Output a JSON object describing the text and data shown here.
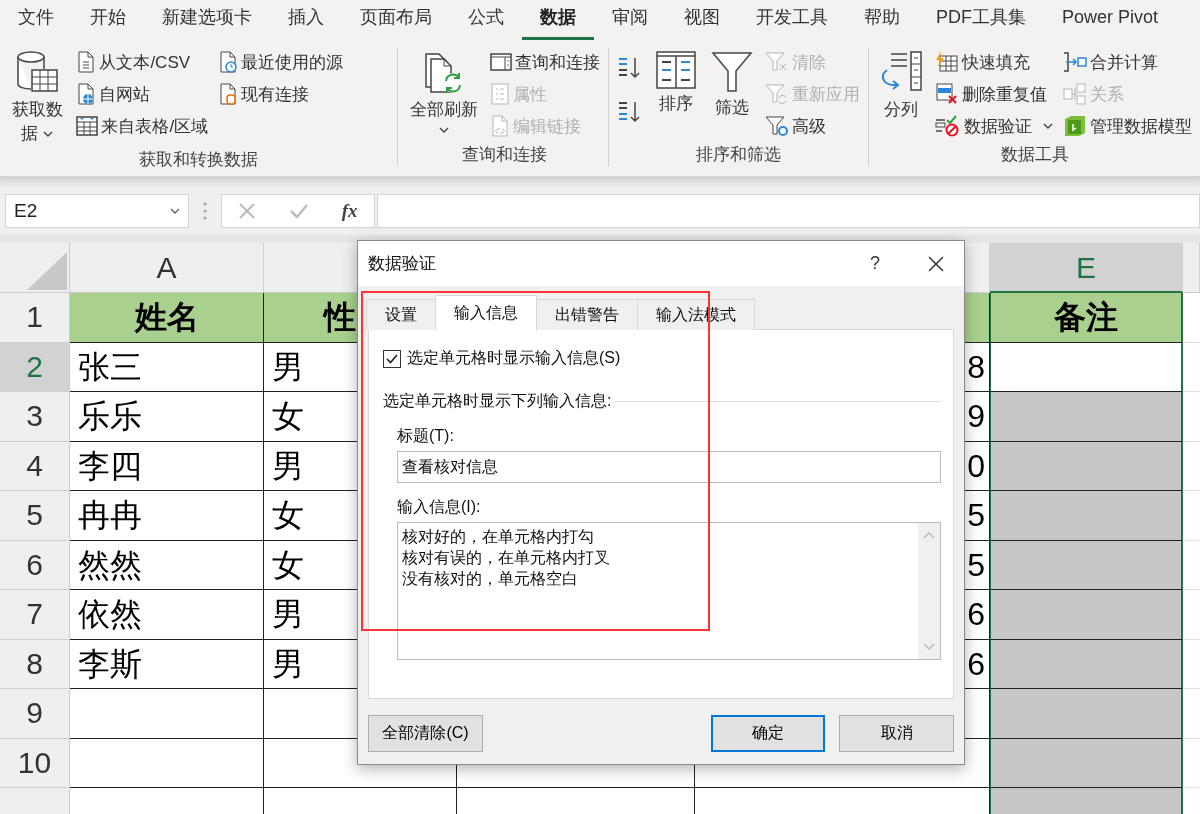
{
  "ribbon": {
    "tabs": [
      {
        "label": "文件",
        "selected": false
      },
      {
        "label": "开始",
        "selected": false
      },
      {
        "label": "新建选项卡",
        "selected": false
      },
      {
        "label": "插入",
        "selected": false
      },
      {
        "label": "页面布局",
        "selected": false
      },
      {
        "label": "公式",
        "selected": false
      },
      {
        "label": "数据",
        "selected": true
      },
      {
        "label": "审阅",
        "selected": false
      },
      {
        "label": "视图",
        "selected": false
      },
      {
        "label": "开发工具",
        "selected": false
      },
      {
        "label": "帮助",
        "selected": false
      },
      {
        "label": "PDF工具集",
        "selected": false
      },
      {
        "label": "Power Pivot",
        "selected": false
      }
    ],
    "groups": [
      {
        "title": "获取和转换数据",
        "items": [
          {
            "kind": "large",
            "label": "获取数据",
            "caret": true,
            "disabled": false
          },
          {
            "kind": "small",
            "label": "从文本/CSV",
            "disabled": false
          },
          {
            "kind": "small",
            "label": "自网站",
            "disabled": false
          },
          {
            "kind": "small",
            "label": "来自表格/区域",
            "disabled": false
          },
          {
            "kind": "small",
            "label": "最近使用的源",
            "disabled": false
          },
          {
            "kind": "small",
            "label": "现有连接",
            "disabled": false
          }
        ]
      },
      {
        "title": "查询和连接",
        "items": [
          {
            "kind": "large",
            "label": "全部刷新",
            "caret": true,
            "disabled": false
          },
          {
            "kind": "small",
            "label": "查询和连接",
            "disabled": false
          },
          {
            "kind": "small",
            "label": "属性",
            "disabled": true
          },
          {
            "kind": "small",
            "label": "编辑链接",
            "disabled": true
          }
        ]
      },
      {
        "title": "排序和筛选",
        "items": [
          {
            "kind": "icon",
            "disabled": false
          },
          {
            "kind": "icon",
            "disabled": false
          },
          {
            "kind": "large",
            "label": "排序",
            "caret": false,
            "disabled": false
          },
          {
            "kind": "large",
            "label": "筛选",
            "caret": false,
            "disabled": false
          },
          {
            "kind": "small",
            "label": "清除",
            "disabled": true
          },
          {
            "kind": "small",
            "label": "重新应用",
            "disabled": true
          },
          {
            "kind": "small",
            "label": "高级",
            "disabled": false
          }
        ]
      },
      {
        "title": "数据工具",
        "items": [
          {
            "kind": "large",
            "label": "分列",
            "caret": false,
            "disabled": false
          },
          {
            "kind": "small",
            "label": "快速填充",
            "disabled": false
          },
          {
            "kind": "small",
            "label": "删除重复值",
            "disabled": false
          },
          {
            "kind": "small",
            "label": "数据验证",
            "caret": true,
            "disabled": false
          },
          {
            "kind": "small",
            "label": "合并计算",
            "disabled": false
          },
          {
            "kind": "small",
            "label": "关系",
            "disabled": true
          },
          {
            "kind": "small",
            "label": "管理数据模型",
            "disabled": false
          }
        ]
      }
    ]
  },
  "formula_bar": {
    "name_box": "E2",
    "function_label": "fx"
  },
  "sheet": {
    "columns": [
      {
        "label": "A",
        "selected": false
      },
      {},
      {},
      {},
      {
        "label": "E",
        "selected": true
      }
    ],
    "rows": [
      {
        "label": "1",
        "selected": false,
        "cells": [
          {
            "kind": "header",
            "text": "姓名"
          },
          {
            "kind": "header",
            "text": "性"
          },
          {
            "kind": "header"
          },
          {
            "kind": "header"
          },
          {
            "kind": "header",
            "text": "备注"
          }
        ]
      },
      {
        "label": "2",
        "selected": true,
        "cells": [
          {
            "kind": "text",
            "text": "张三"
          },
          {
            "kind": "text",
            "text": "男"
          },
          {
            "kind": "text"
          },
          {
            "kind": "text",
            "text": "8"
          },
          {
            "kind": "text"
          }
        ]
      },
      {
        "label": "3",
        "selected": false,
        "cells": [
          {
            "kind": "text",
            "text": "乐乐"
          },
          {
            "kind": "text",
            "text": "女"
          },
          {
            "kind": "text"
          },
          {
            "kind": "text",
            "text": "9"
          },
          {
            "kind": "shaded"
          }
        ]
      },
      {
        "label": "4",
        "selected": false,
        "cells": [
          {
            "kind": "text",
            "text": "李四"
          },
          {
            "kind": "text",
            "text": "男"
          },
          {
            "kind": "text"
          },
          {
            "kind": "text",
            "text": "0"
          },
          {
            "kind": "shaded"
          }
        ]
      },
      {
        "label": "5",
        "selected": false,
        "cells": [
          {
            "kind": "text",
            "text": "冉冉"
          },
          {
            "kind": "text",
            "text": "女"
          },
          {
            "kind": "text"
          },
          {
            "kind": "text",
            "text": "5"
          },
          {
            "kind": "shaded"
          }
        ]
      },
      {
        "label": "6",
        "selected": false,
        "cells": [
          {
            "kind": "text",
            "text": "然然"
          },
          {
            "kind": "text",
            "text": "女"
          },
          {
            "kind": "text"
          },
          {
            "kind": "text",
            "text": "5"
          },
          {
            "kind": "shaded"
          }
        ]
      },
      {
        "label": "7",
        "selected": false,
        "cells": [
          {
            "kind": "text",
            "text": "依然"
          },
          {
            "kind": "text",
            "text": "男"
          },
          {
            "kind": "text"
          },
          {
            "kind": "text",
            "text": "6"
          },
          {
            "kind": "shaded"
          }
        ]
      },
      {
        "label": "8",
        "selected": false,
        "cells": [
          {
            "kind": "text",
            "text": "李斯"
          },
          {
            "kind": "text",
            "text": "男"
          },
          {
            "kind": "text"
          },
          {
            "kind": "text",
            "text": "6"
          },
          {
            "kind": "shaded"
          }
        ]
      },
      {
        "label": "9",
        "selected": false,
        "cells": [
          {
            "kind": "text"
          },
          {
            "kind": "text"
          },
          {
            "kind": "text"
          },
          {
            "kind": "text"
          },
          {
            "kind": "shaded"
          }
        ]
      },
      {
        "label": "10",
        "selected": false,
        "cells": [
          {
            "kind": "text"
          },
          {
            "kind": "text"
          },
          {
            "kind": "text"
          },
          {
            "kind": "text"
          },
          {
            "kind": "shaded"
          }
        ]
      },
      {
        "selected": false,
        "cells": [
          {
            "kind": "text"
          },
          {
            "kind": "text"
          },
          {
            "kind": "text"
          },
          {
            "kind": "text"
          },
          {
            "kind": "shaded"
          }
        ]
      }
    ]
  },
  "dialog": {
    "title": "数据验证",
    "help": "?",
    "tabs": [
      {
        "label": "设置",
        "selected": false
      },
      {
        "label": "输入信息",
        "selected": true
      },
      {
        "label": "出错警告",
        "selected": false
      },
      {
        "label": "输入法模式",
        "selected": false
      }
    ],
    "show_message": {
      "label": "选定单元格时显示输入信息(S)",
      "checked": true
    },
    "section_label": "选定单元格时显示下列输入信息:",
    "title_field": {
      "label": "标题(T):",
      "value": "查看核对信息"
    },
    "message_field": {
      "label": "输入信息(I):",
      "lines": [
        "核对好的，在单元格内打勾",
        "核对有误的，在单元格内打叉",
        "没有核对的，单元格空白"
      ]
    },
    "buttons": [
      {
        "label": "全部清除(C)",
        "kind": "secondary"
      },
      {
        "label": "确定",
        "kind": "default"
      },
      {
        "label": "取消",
        "kind": "secondary"
      }
    ],
    "highlight": {
      "color": "#ff3333"
    }
  }
}
